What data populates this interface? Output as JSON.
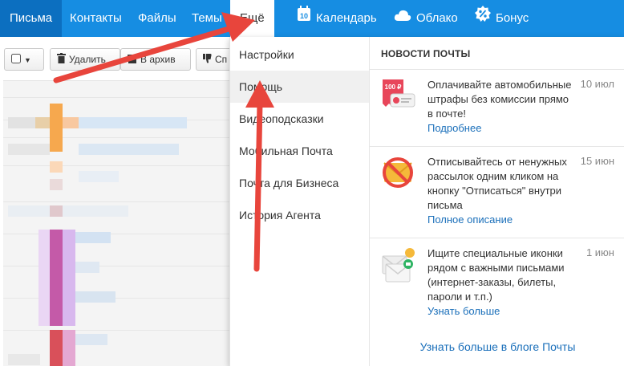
{
  "topnav": {
    "mail": "Письма",
    "contacts": "Контакты",
    "files": "Файлы",
    "topics": "Темы",
    "more": "Ещё",
    "calendar": "Календарь",
    "calendar_day": "10",
    "cloud": "Облако",
    "bonus": "Бонус"
  },
  "toolbar": {
    "delete": "Удалить",
    "archive": "В архив",
    "spam": "Сп"
  },
  "menu": {
    "items": [
      "Настройки",
      "Помощь",
      "Видеоподсказки",
      "Мобильная Почта",
      "Почта для Бизнеса",
      "История Агента"
    ]
  },
  "news": {
    "title": "НОВОСТИ ПОЧТЫ",
    "items": [
      {
        "text": "Оплачивайте автомобильные штрафы без комиссии прямо в почте!",
        "date": "10 июл",
        "link": "Подробнее",
        "thumb_label": "100 ₽"
      },
      {
        "text": "Отписывайтесь от ненужных рассылок одним кликом на кнопку \"Отписаться\" внутри письма",
        "date": "15 июн",
        "link": "Полное описание"
      },
      {
        "text": "Ищите специальные иконки рядом с важными письмами (интернет-заказы, билеты, пароли и т.п.)",
        "date": "1 июн",
        "link": "Узнать больше"
      }
    ],
    "blog_link": "Узнать больше в блоге Почты"
  },
  "colors": {
    "nav_bg": "#168de2",
    "nav_active": "#0c6fc0",
    "link": "#1a6fba",
    "arrow": "#e8453c"
  }
}
